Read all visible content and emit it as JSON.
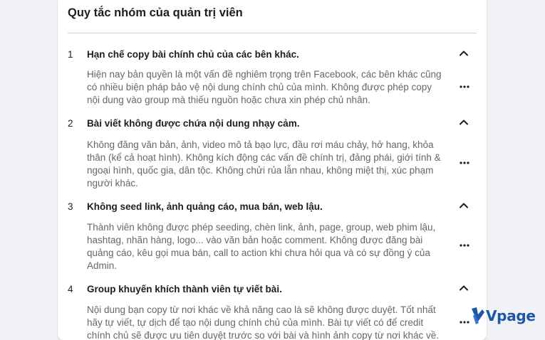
{
  "panel": {
    "title": "Quy tắc nhóm của quản trị viên"
  },
  "rules": [
    {
      "number": "1",
      "title": "Hạn chế copy bài chính chủ của các bên khác.",
      "lines": [
        "Hiện nay bản quyền là một vấn đề nghiêm trọng trên Facebook, các bên khác cũng",
        "có nhiều biện pháp bảo vệ nội dung chính chủ của mình. Không được phép copy",
        "nội dung vào group mà thiếu nguồn hoặc chưa xin phép chủ nhân."
      ]
    },
    {
      "number": "2",
      "title": "Bài viết không được chứa nội dung nhạy cảm.",
      "lines": [
        "Không đăng văn bản, ảnh, video mô tả bạo lực, đầu rơi máu chảy, hở hang, khỏa",
        "thân (kể cả hoạt hình). Không kích động các vấn đề chính trị, đảng phái, giới tính &",
        "ngoại hình, quốc gia, dân tộc. Không chửi rủa lẫn nhau, không miệt thị, xúc phạm",
        "người khác."
      ]
    },
    {
      "number": "3",
      "title": "Không seed link, ảnh quảng cáo, mua bán, web lậu.",
      "lines": [
        "Thành viên không được phép seeding, chèn link, ảnh, page, group, web phim lậu,",
        "hashtag, nhãn hàng, logo... vào văn bản hoặc comment. Không được đăng bài",
        "quảng cáo, kêu gọi mua bán, call to action khi chưa hỏi qua và có sự đồng ý của",
        "Admin."
      ]
    },
    {
      "number": "4",
      "title": "Group khuyến khích thành viên tự viết bài.",
      "lines": [
        "Nội dung bạn copy từ nơi khác về khả năng cao là sẽ không được duyệt. Tốt nhất",
        "hãy tự viết, tự dịch để tạo nội dung chính chủ của mình. Bài tự viết có để credit",
        "chính chủ sẽ được ưu tiên duyệt trước so với bài và hình ảnh copy từ nơi khác về."
      ]
    }
  ],
  "watermark": {
    "text": "Vpage",
    "color": "#1e56a8"
  },
  "colors": {
    "background": "#f0f2f5",
    "card": "#ffffff",
    "title_text": "#1c1e21",
    "secondary_text": "#65676b"
  },
  "icons": {
    "collapse": "chevron-up-icon",
    "options": "more-icon"
  }
}
